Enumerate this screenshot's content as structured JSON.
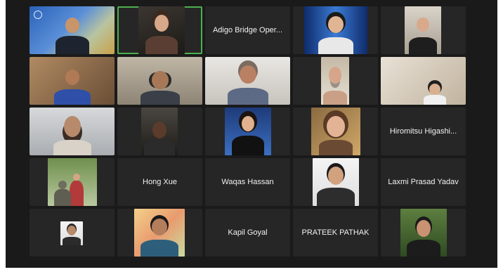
{
  "gallery": {
    "tiles": [
      {
        "type": "video",
        "scene": "blue-bridge",
        "icon": "person-video"
      },
      {
        "type": "video",
        "scene": "dark-room",
        "icon": "person-video",
        "speaking": true
      },
      {
        "type": "name",
        "label": "Adigo Bridge Oper..."
      },
      {
        "type": "video",
        "scene": "tech-background",
        "icon": "person-video"
      },
      {
        "type": "video",
        "scene": "office-window",
        "icon": "person-video"
      },
      {
        "type": "video",
        "scene": "warm-room",
        "icon": "person-video"
      },
      {
        "type": "video",
        "scene": "shelves-headphones",
        "icon": "person-video"
      },
      {
        "type": "video",
        "scene": "white-wall",
        "icon": "person-video"
      },
      {
        "type": "video",
        "scene": "wood-panel",
        "icon": "person-video"
      },
      {
        "type": "video",
        "scene": "hotel-room",
        "icon": "person-video"
      },
      {
        "type": "video",
        "scene": "grey-wall",
        "icon": "person-video"
      },
      {
        "type": "video",
        "scene": "car-interior",
        "icon": "person-video"
      },
      {
        "type": "video",
        "scene": "white-studio",
        "icon": "person-video"
      },
      {
        "type": "video",
        "scene": "gold-light",
        "icon": "person-video"
      },
      {
        "type": "name",
        "label": "Hiromitsu Higashi..."
      },
      {
        "type": "video",
        "scene": "garden-photo",
        "icon": "person-video"
      },
      {
        "type": "name",
        "label": "Hong Xue"
      },
      {
        "type": "name",
        "label": "Waqas Hassan"
      },
      {
        "type": "video",
        "scene": "studio-portrait",
        "icon": "person-video"
      },
      {
        "type": "name",
        "label": "Laxmi Prasad Yadav"
      },
      {
        "type": "video",
        "scene": "small-portrait",
        "icon": "person-video"
      },
      {
        "type": "video",
        "scene": "sticky-notes",
        "icon": "person-video"
      },
      {
        "type": "name",
        "label": "Kapil Goyal"
      },
      {
        "type": "name",
        "label": "PRATEEK PATHAK"
      },
      {
        "type": "video",
        "scene": "trees-outdoor",
        "icon": "person-video"
      }
    ]
  },
  "colors": {
    "window_bg": "#1a1a1a",
    "tile_bg": "#262626",
    "name_text": "#f2f2f2",
    "active_speaker": "#4caf50"
  }
}
